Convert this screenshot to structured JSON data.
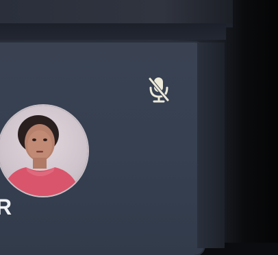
{
  "participant_tile": {
    "initial": "R",
    "mic_state": "muted",
    "mic_icon": "mic-off-icon",
    "avatar": "participant-photo"
  },
  "colors": {
    "tile_bg": "#38404f",
    "mic_icon": "#ece9d8",
    "background": "#0b0c0f"
  }
}
